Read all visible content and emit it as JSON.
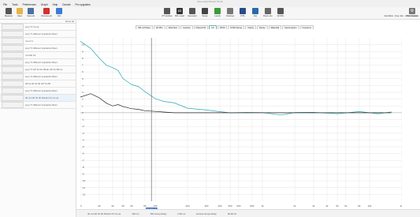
{
  "window": {
    "title": "Room EQ Wizard V5.30"
  },
  "menu": [
    "File",
    "Tools",
    "Preferences",
    "Graph",
    "Help",
    "Donate",
    "Pro upgrades"
  ],
  "toolbar_left": [
    {
      "label": "Measure",
      "icon": "microphone-icon",
      "color": "#555555"
    },
    {
      "label": "Open",
      "icon": "folder-icon",
      "color": "#e8b443"
    },
    {
      "label": "Save all",
      "icon": "save-icon",
      "color": "#4a6fa5"
    },
    {
      "label": "Remove all",
      "icon": "remove-icon",
      "color": "#d03030"
    },
    {
      "label": "Info",
      "icon": "info-icon",
      "color": "#3a7bd5"
    }
  ],
  "toolbar_center": [
    {
      "label": "RT window",
      "value": "",
      "icon": "rt-icon",
      "color": "#555555"
    },
    {
      "label": "SPL meter",
      "value": "83",
      "icon": "spl-icon",
      "color": "#333333"
    },
    {
      "label": "Generator",
      "value": "",
      "icon": "generator-icon",
      "color": "#555555"
    },
    {
      "label": "Scope",
      "value": "",
      "icon": "scope-icon",
      "color": "#444444"
    },
    {
      "label": "Levels",
      "value": "",
      "icon": "levels-icon",
      "color": "#3a9a3a"
    },
    {
      "label": "Overlays",
      "value": "",
      "icon": "overlays-icon",
      "color": "#777777"
    },
    {
      "label": "RTA",
      "value": "",
      "icon": "rta-icon",
      "color": "#2a4a8a"
    },
    {
      "label": "EQ",
      "value": "",
      "icon": "eq-icon",
      "color": "#2a6aaa"
    },
    {
      "label": "Room sim",
      "value": "",
      "icon": "room-sim-icon",
      "color": "#666666"
    },
    {
      "label": "All SPL",
      "value": "",
      "icon": "all-spl-icon",
      "color": "#555555"
    }
  ],
  "toolbar_right": {
    "label": "Preferences",
    "icon": "gear-icon"
  },
  "right_tools": [
    "Auto Mono",
    "Freq. Axis",
    "Limits",
    "Controls"
  ],
  "sidebar": {
    "header_left": "",
    "header_right": "Show all",
    "items": [
      {
        "name": "avg 7.5 ms as"
      },
      {
        "name": "avg 7.5 different loopbacks filters"
      },
      {
        "name": "ms ref 1"
      },
      {
        "name": "avg 7.5 different loopbacks filters"
      },
      {
        "name": "ms Mar 16"
      },
      {
        "name": "avg 7.5 different loopbacks filters"
      },
      {
        "name": "avg 7.5 HP 32 db 30Lab HP 24 dB ms"
      },
      {
        "name": "avg 7.5 different loopbacks filters"
      },
      {
        "name": "40ms HP 32 db HP 24 dB"
      },
      {
        "name": "avg 7.5 different loopbacks filters"
      },
      {
        "name": "40 ms HP 32 db 30Lab LT2 ms as"
      },
      {
        "name": "avg 7.5 different loopbacks filters"
      }
    ]
  },
  "tabs": [
    "SPL & Phase",
    "All SPL",
    "Distortion",
    "Impulse",
    "Filtered IR",
    "GD",
    "RT60",
    "RT60 Decay",
    "Clarity",
    "Decay",
    "Waterfall",
    "Spectrogram",
    "Cepstrum"
  ],
  "active_tab": "GD",
  "chart_data": {
    "type": "line",
    "xlabel": "",
    "ylabel": "",
    "x_scale": "log",
    "xlim": [
      20,
      20000
    ],
    "ylim": [
      -13,
      11
    ],
    "x_ticks": [
      "20",
      "30",
      "40",
      "50",
      "60",
      "80",
      "100",
      "200",
      "300",
      "400",
      "500",
      "600",
      "800",
      "1k",
      "2k",
      "3k",
      "4k",
      "5k",
      "6k",
      "8k",
      "10k",
      "20k"
    ],
    "y_ticks": [
      "10",
      "9",
      "8",
      "7",
      "6",
      "5",
      "4",
      "3",
      "2",
      "1",
      "0",
      "-1",
      "-2",
      "-3",
      "-4",
      "-5",
      "-6",
      "-7",
      "-8",
      "-9",
      "-10",
      "-11",
      "-12"
    ],
    "series": [
      {
        "name": "",
        "color": "#2aa7b0",
        "x": [
          20,
          25,
          30,
          35,
          40,
          45,
          50,
          60,
          70,
          80,
          100,
          120,
          150,
          200,
          300,
          400,
          500,
          700,
          1000,
          1500,
          2000,
          3000,
          5000,
          8000,
          12000,
          16000
        ],
        "y": [
          10.5,
          9.2,
          8.1,
          7.2,
          6.5,
          6.0,
          5.2,
          4.3,
          3.6,
          3.0,
          2.3,
          1.7,
          1.2,
          0.7,
          0.3,
          0.15,
          0.1,
          -0.1,
          0.1,
          -0.3,
          -0.1,
          0.2,
          -0.2,
          0.1,
          0.0,
          0.0
        ]
      },
      {
        "name": "",
        "color": "#222222",
        "x": [
          20,
          25,
          30,
          35,
          40,
          45,
          50,
          60,
          70,
          80,
          100,
          120,
          150,
          200,
          300,
          500,
          1000,
          2000,
          5000,
          10000,
          16000
        ],
        "y": [
          2.3,
          2.8,
          2.2,
          1.4,
          1.0,
          1.2,
          0.9,
          0.6,
          0.5,
          0.3,
          0.2,
          0.1,
          0.0,
          0.0,
          0.0,
          0.0,
          0.0,
          0.0,
          0.0,
          0.0,
          0.0
        ]
      }
    ],
    "cursor_x": 92,
    "cursor_label": "92.00 Hz"
  },
  "status": {
    "left": "40 ms HP 32 db 30Lab LT2 ms as",
    "mid1": "100 ms",
    "mid2": "30k Group Delay",
    "mid3": "2.50 ms",
    "mid4": "Excess Group Delay",
    "right": "92.00 Hz"
  }
}
